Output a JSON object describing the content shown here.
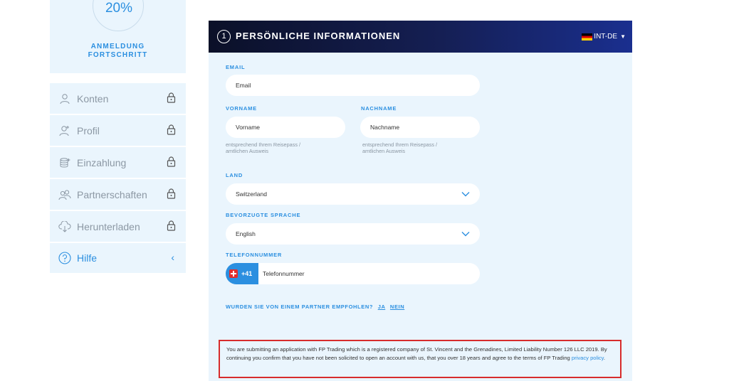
{
  "sidebar": {
    "progress_value": "20%",
    "progress_label_line1": "ANMELDUNG",
    "progress_label_line2": "FORTSCHRITT",
    "items": [
      {
        "label": "Konten",
        "icon": "user-icon",
        "locked": true
      },
      {
        "label": "Profil",
        "icon": "user-plus-icon",
        "locked": true
      },
      {
        "label": "Einzahlung",
        "icon": "coins-icon",
        "locked": true
      },
      {
        "label": "Partnerschaften",
        "icon": "partners-icon",
        "locked": true
      },
      {
        "label": "Herunterladen",
        "icon": "cloud-download-icon",
        "locked": true
      }
    ],
    "help_label": "Hilfe",
    "help_chevron": "‹"
  },
  "header": {
    "step": "1",
    "title": "PERSÖNLICHE INFORMATIONEN",
    "language": "INT-DE"
  },
  "form": {
    "email_label": "EMAIL",
    "email_placeholder": "Email",
    "firstname_label": "VORNAME",
    "firstname_placeholder": "Vorname",
    "firstname_hint_line1": "entsprechend Ihrem Reisepass /",
    "firstname_hint_line2": "amtlichen Ausweis",
    "lastname_label": "NACHNAME",
    "lastname_placeholder": "Nachname",
    "lastname_hint_line1": "entsprechend Ihrem Reisepass /",
    "lastname_hint_line2": "amtlichen Ausweis",
    "country_label": "LAND",
    "country_value": "Switzerland",
    "language_label": "BEVORZUGTE SPRACHE",
    "language_value": "English",
    "phone_label": "TELEFONNUMMER",
    "phone_prefix": "+41",
    "phone_placeholder": "Telefonnummer",
    "partner_question": "WURDEN SIE VON EINEM PARTNER EMPFOHLEN?",
    "partner_yes": "JA",
    "partner_no": "NEIN"
  },
  "disclaimer": {
    "text": "You are submitting an application with FP Trading which is a registered company of St. Vincent and the Grenadines, Limited Liability Number 126 LLC 2019. By continuing you confirm that you have not been solicited to open an account with us, that you over 18 years and agree to the terms of FP Trading",
    "link": "privacy policy",
    "end": "."
  },
  "colors": {
    "accent": "#2b8fe0",
    "panel_bg": "#eaf5fd",
    "header_dark": "#0b1028",
    "header_blue": "#1a2f8f",
    "border_red": "#d72c2c"
  }
}
